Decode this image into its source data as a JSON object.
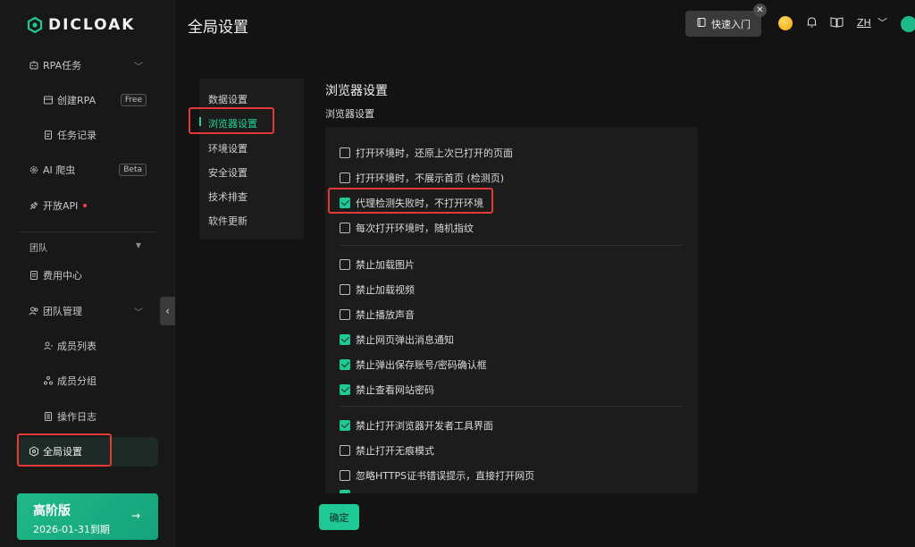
{
  "brand": {
    "name": "DICLOAK",
    "accent": "#1fc894"
  },
  "sidebar": {
    "rpa": {
      "label": "RPA任务"
    },
    "create_rpa": {
      "label": "创建RPA",
      "badge": "Free"
    },
    "task_log": {
      "label": "任务记录"
    },
    "ai_crawler": {
      "label": "AI 爬虫",
      "badge": "Beta"
    },
    "open_api": {
      "label": "开放API"
    },
    "team_section": "团队",
    "billing": {
      "label": "费用中心"
    },
    "team_mgmt": {
      "label": "团队管理"
    },
    "members": {
      "label": "成员列表"
    },
    "groups": {
      "label": "成员分组"
    },
    "op_log": {
      "label": "操作日志"
    },
    "global_settings": {
      "label": "全局设置"
    },
    "premium": {
      "title": "高阶版",
      "expiry": "2026-01-31到期"
    }
  },
  "header": {
    "title": "全局设置",
    "quick_start": "快速入门",
    "lang": "ZH"
  },
  "subnav": {
    "items": [
      "数据设置",
      "浏览器设置",
      "环境设置",
      "安全设置",
      "技术排查",
      "软件更新"
    ],
    "active": "浏览器设置"
  },
  "main": {
    "title": "浏览器设置",
    "subtitle": "浏览器设置",
    "options": [
      {
        "label": "打开环境时，还原上次已打开的页面",
        "checked": false
      },
      {
        "label": "打开环境时，不展示首页 (检测页)",
        "checked": false
      },
      {
        "label": "代理检测失败时，不打开环境",
        "checked": true
      },
      {
        "label": "每次打开环境时，随机指纹",
        "checked": false
      },
      {
        "label": "禁止加载图片",
        "checked": false
      },
      {
        "label": "禁止加载视频",
        "checked": false
      },
      {
        "label": "禁止播放声音",
        "checked": false
      },
      {
        "label": "禁止网页弹出消息通知",
        "checked": true
      },
      {
        "label": "禁止弹出保存账号/密码确认框",
        "checked": true
      },
      {
        "label": "禁止查看网站密码",
        "checked": true
      },
      {
        "label": "禁止打开浏览器开发者工具界面",
        "checked": true
      },
      {
        "label": "禁止打开无痕模式",
        "checked": false
      },
      {
        "label": "忽略HTTPS证书错误提示，直接打开网页",
        "checked": false
      }
    ],
    "confirm": "确定"
  }
}
